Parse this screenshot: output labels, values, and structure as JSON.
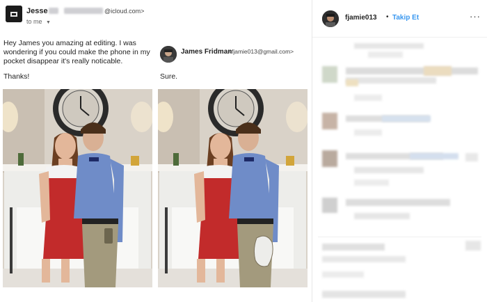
{
  "email": {
    "first": {
      "sender_name": "Jesse",
      "sender_email_suffix": "@icloud.com>",
      "to_label": "to me",
      "body": "Hey James you amazing at editing. I was wondering if you could make the phone in my pocket disappear it's really noticable.",
      "signoff": "Thanks!"
    },
    "reply": {
      "sender_name": "James Fridman",
      "sender_email": "<fjamie013@gmail.com>",
      "body": "Sure."
    }
  },
  "instagram": {
    "username": "fjamie013",
    "separator": "•",
    "follow_label": "Takip Et",
    "more_label": "···"
  },
  "colors": {
    "link_blue": "#3897f0",
    "dress_red": "#c22b2b",
    "shirt_blue": "#6f8cc8",
    "wall": "#d9d2c8"
  }
}
